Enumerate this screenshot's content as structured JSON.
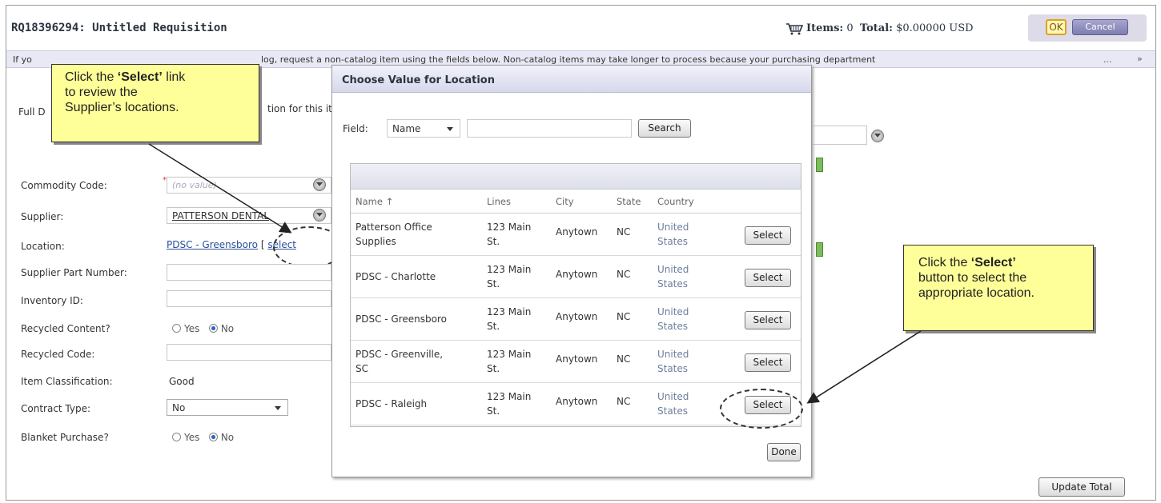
{
  "header": {
    "title": "RQ18396294: Untitled Requisition",
    "items_label": "Items:",
    "items_count": "0",
    "total_label": "Total:",
    "total_value": "$0.00000 USD",
    "ok_label": "OK",
    "cancel_label": "Cancel"
  },
  "info": {
    "text_left": "If yo",
    "text_right": "log, request a non-catalog item using the fields below. Non-catalog items may take longer to process because your purchasing department",
    "more": "...",
    "expand": "»"
  },
  "form": {
    "full_desc_label_partial": "Full D",
    "full_desc_right_partial": "tion for this it",
    "commodity_label": "Commodity Code:",
    "commodity_placeholder": "(no value)",
    "supplier_label": "Supplier:",
    "supplier_value": "PATTERSON DENTAL",
    "location_label": "Location:",
    "location_value": "PDSC - Greensboro",
    "location_select_open": "[",
    "location_select_link": "select",
    "supplier_part_label": "Supplier Part Number:",
    "inventory_label": "Inventory ID:",
    "recycled_content_label": "Recycled Content?",
    "recycled_code_label": "Recycled Code:",
    "item_class_label": "Item Classification:",
    "item_class_value": "Good",
    "contract_label": "Contract Type:",
    "contract_value": "No",
    "blanket_label": "Blanket Purchase?",
    "yes_label": "Yes",
    "no_label": "No",
    "update_total": "Update Total"
  },
  "callouts": {
    "left_prefix": "Click the ",
    "left_bold": "‘Select’",
    "left_suffix": " link",
    "left_line2": "to review the",
    "left_line3": "Supplier’s locations.",
    "right_prefix": "Click the ",
    "right_bold": "‘Select’",
    "right_line2": "button to select the",
    "right_line3": "appropriate location."
  },
  "modal": {
    "title": "Choose Value for Location",
    "field_label": "Field:",
    "field_value": "Name",
    "search_button": "Search",
    "columns": {
      "name": "Name",
      "sort": "↑",
      "lines": "Lines",
      "city": "City",
      "state": "State",
      "country": "Country"
    },
    "rows": [
      {
        "name1": "Patterson Office",
        "name2": "Supplies",
        "lines1": "123 Main",
        "lines2": "St.",
        "city": "Anytown",
        "state": "NC",
        "country1": "United",
        "country2": "States",
        "action": "Select"
      },
      {
        "name1": "PDSC - Charlotte",
        "name2": "",
        "lines1": "123 Main",
        "lines2": "St.",
        "city": "Anytown",
        "state": "NC",
        "country1": "United",
        "country2": "States",
        "action": "Select"
      },
      {
        "name1": "PDSC - Greensboro",
        "name2": "",
        "lines1": "123 Main",
        "lines2": "St.",
        "city": "Anytown",
        "state": "NC",
        "country1": "United",
        "country2": "States",
        "action": "Select"
      },
      {
        "name1": "PDSC - Greenville,",
        "name2": "SC",
        "lines1": "123 Main",
        "lines2": "St.",
        "city": "Anytown",
        "state": "NC",
        "country1": "United",
        "country2": "States",
        "action": "Select"
      },
      {
        "name1": "PDSC - Raleigh",
        "name2": "",
        "lines1": "123 Main",
        "lines2": "St.",
        "city": "Anytown",
        "state": "NC",
        "country1": "United",
        "country2": "States",
        "action": "Select"
      }
    ],
    "done_button": "Done"
  }
}
